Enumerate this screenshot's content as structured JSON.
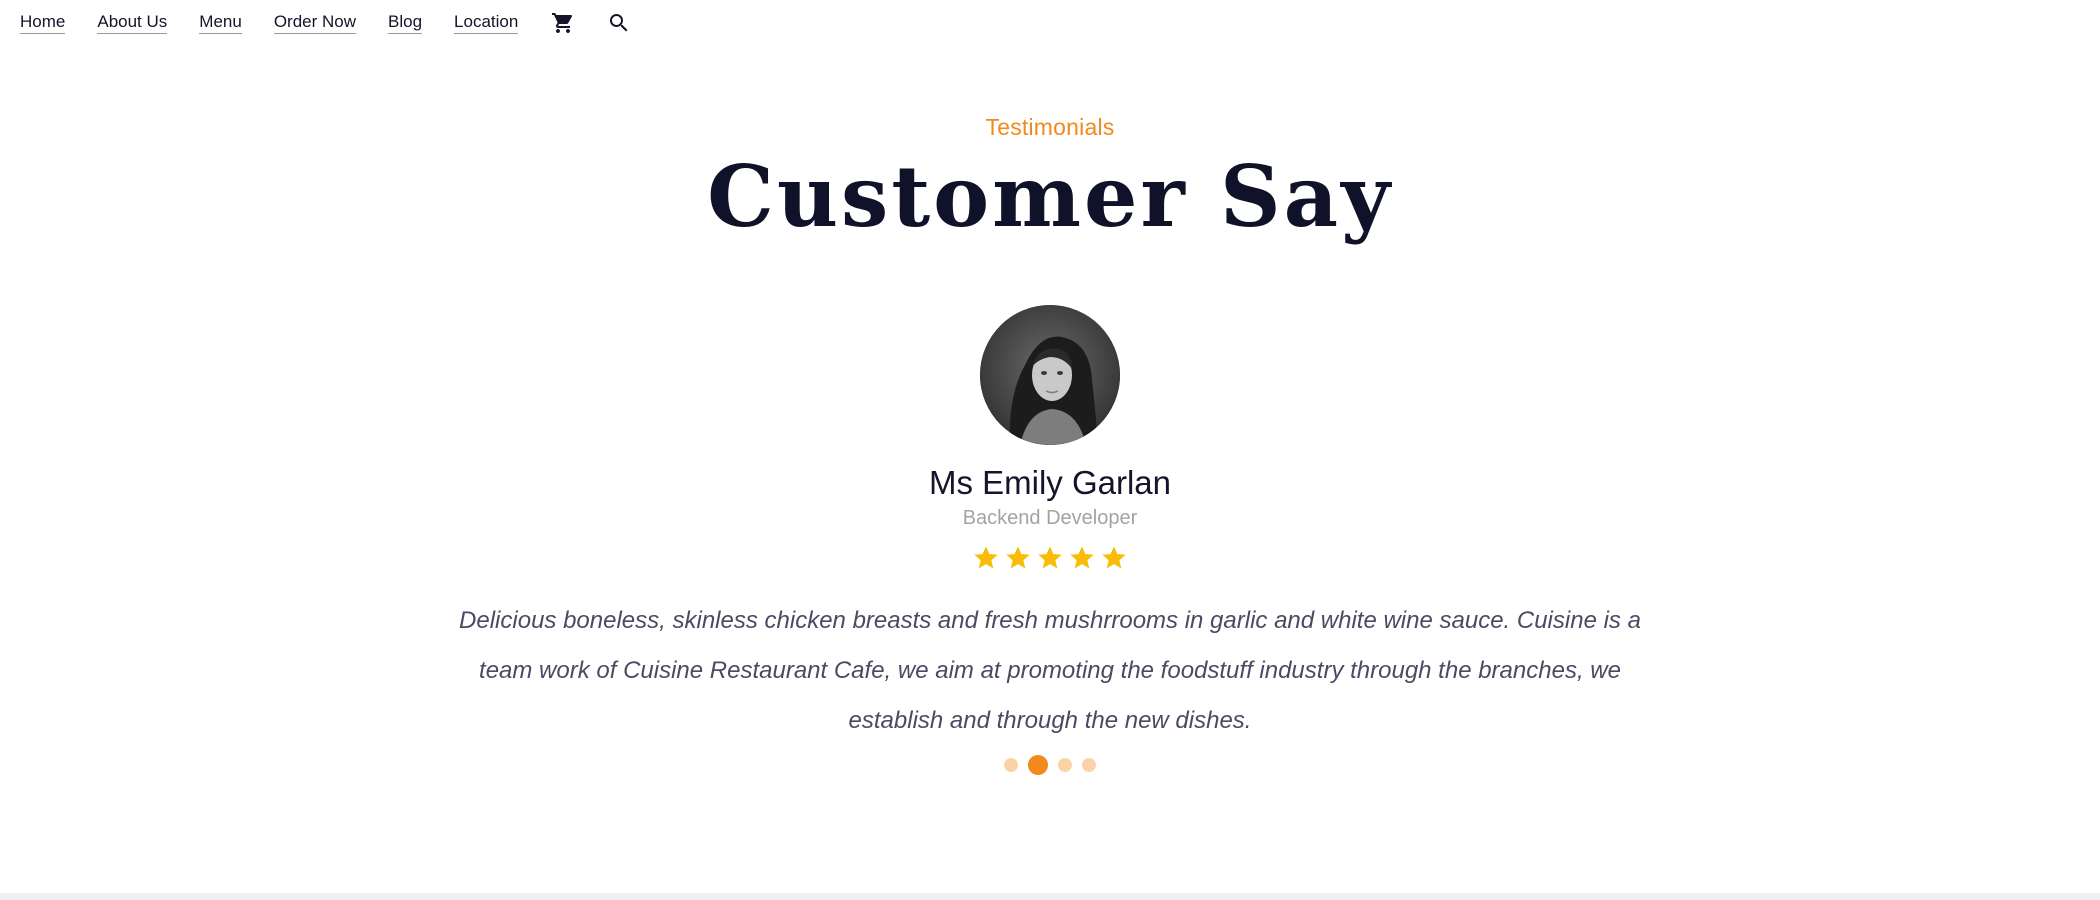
{
  "nav": {
    "links": [
      "Home",
      "About Us",
      "Menu",
      "Order Now",
      "Blog",
      "Location"
    ],
    "icons": [
      "cart-icon",
      "search-icon"
    ]
  },
  "testimonials": {
    "eyebrow": "Testimonials",
    "title": "Customer Say",
    "name": "Ms Emily Garlan",
    "role": "Backend Developer",
    "rating": 5,
    "rating_max": 5,
    "quote": "Delicious boneless, skinless chicken breasts and fresh mushrrooms in garlic and white wine sauce. Cuisine is a team work of Cuisine Restaurant Cafe, we aim at promoting the foodstuff industry through the branches, we establish and through the new dishes.",
    "carousel": {
      "count": 4,
      "active_index": 1
    }
  },
  "colors": {
    "accent": "#f2891d",
    "star": "#fbbc05",
    "heading": "#0f1228",
    "muted": "#a3a3a3",
    "quote": "#4a4b63",
    "dot_inactive": "#fbd3a6"
  }
}
